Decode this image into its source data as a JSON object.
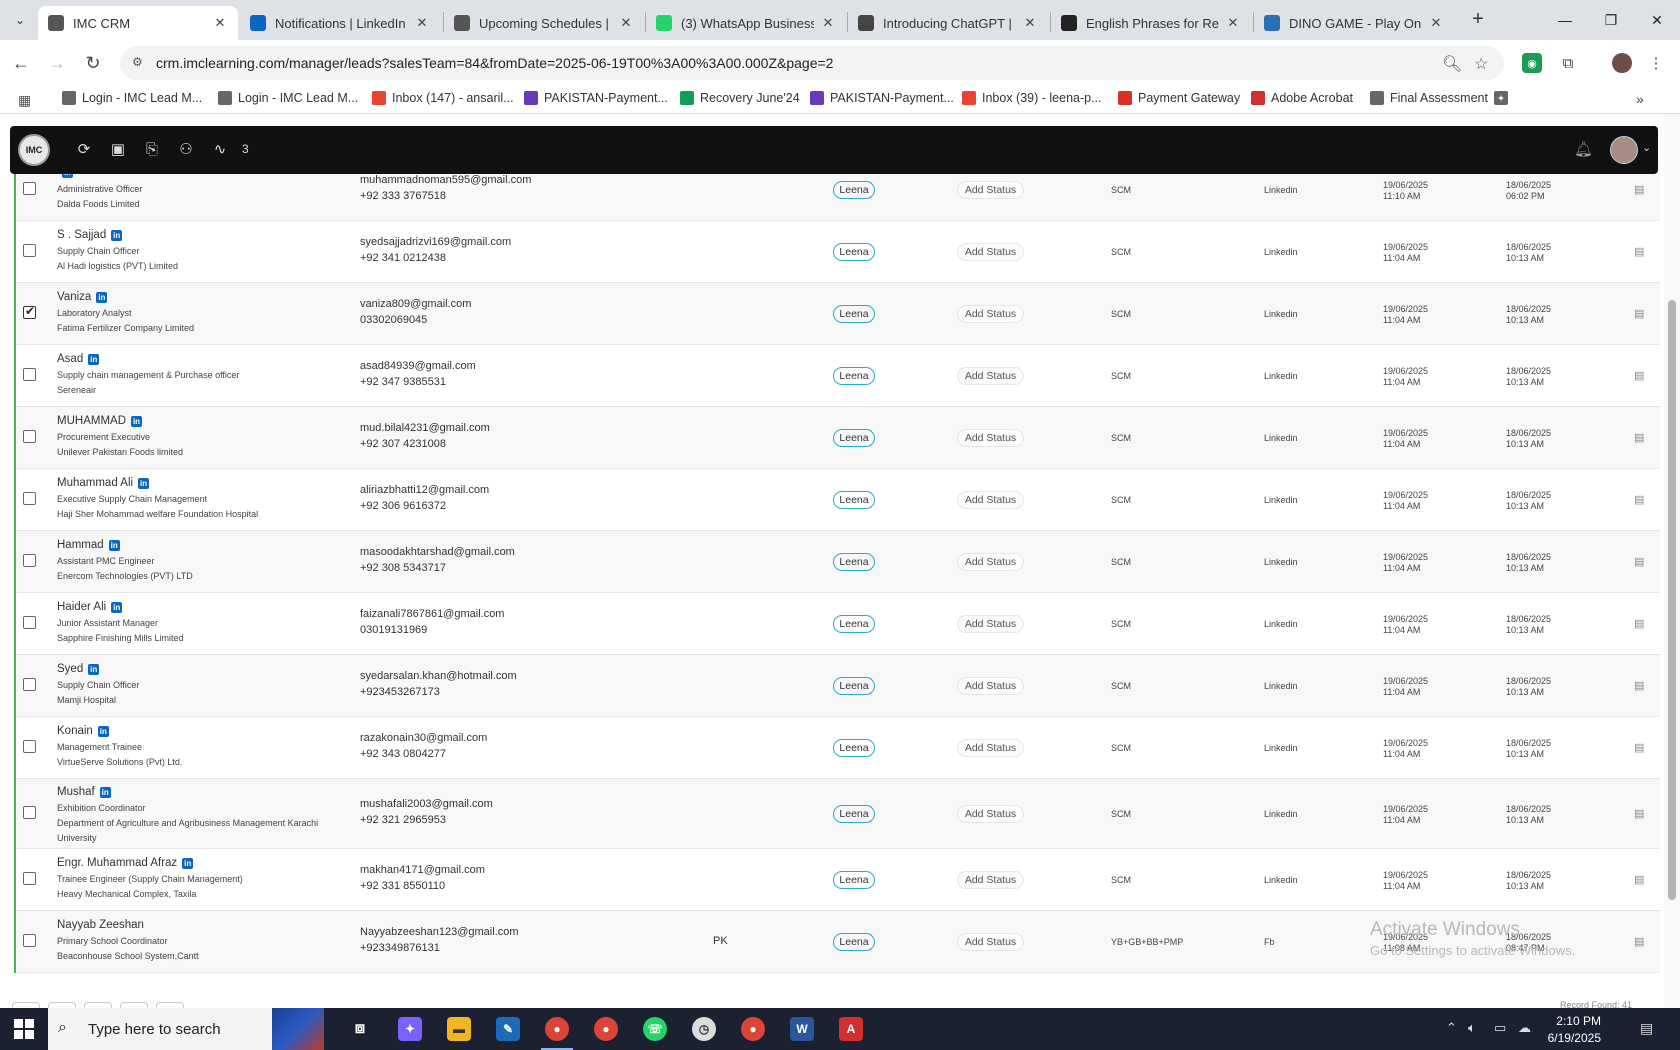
{
  "browser": {
    "tabs": [
      {
        "title": "IMC CRM",
        "favicon": "imc-icon",
        "color": "#555555"
      },
      {
        "title": "Notifications | LinkedIn",
        "favicon": "linkedin-icon",
        "color": "#0a66c2"
      },
      {
        "title": "Upcoming Schedules | IM",
        "favicon": "imc-icon",
        "color": "#555555"
      },
      {
        "title": "(3) WhatsApp Business",
        "favicon": "whatsapp-icon",
        "color": "#25d366"
      },
      {
        "title": "Introducing ChatGPT | O",
        "favicon": "openai-icon",
        "color": "#444444"
      },
      {
        "title": "English Phrases for Reas",
        "favicon": "openai-icon",
        "color": "#222222"
      },
      {
        "title": "DINO GAME - Play Onlin",
        "favicon": "dino-icon",
        "color": "#2a6fb0"
      }
    ],
    "url": "crm.imclearning.com/manager/leads?salesTeam=84&fromDate=2025-06-19T00%3A00%3A00.000Z&page=2",
    "bookmarks": [
      {
        "label": "Login - IMC Lead M...",
        "color": "#666666"
      },
      {
        "label": "Login - IMC Lead M...",
        "color": "#666666"
      },
      {
        "label": "Inbox (147) - ansaril...",
        "color": "#ea4335"
      },
      {
        "label": "PAKISTAN-Payment...",
        "color": "#673ab7"
      },
      {
        "label": "Recovery June'24",
        "color": "#0f9d58"
      },
      {
        "label": "PAKISTAN-Payment...",
        "color": "#673ab7"
      },
      {
        "label": "Inbox (39) - leena-p...",
        "color": "#ea4335"
      },
      {
        "label": "Payment Gateway",
        "color": "#d93025"
      },
      {
        "label": "Adobe Acrobat",
        "color": "#d32f2f"
      },
      {
        "label": "Final Assessment",
        "color": "#666666"
      }
    ]
  },
  "app": {
    "header_count": "3"
  },
  "leads": [
    {
      "name": "",
      "title": "Administrative Officer",
      "company": "Dalda Foods Limited",
      "org2": "",
      "email": "muhammadnoman595@gmail.com",
      "phone": "+92 333 3767518",
      "country": "",
      "owner": "Leena",
      "status": "Add Status",
      "course": "SCM",
      "source": "Linkedin",
      "date1": "19/06/2025",
      "time1": "11:10 AM",
      "date2": "18/06/2025",
      "time2": "06:02 PM",
      "checked": false,
      "linkedin": true
    },
    {
      "name": "S . Sajjad",
      "title": "Supply Chain Officer",
      "company": "Al Hadi logistics (PVT) Limited",
      "org2": "",
      "email": "syedsajjadrizvi169@gmail.com",
      "phone": "+92 341 0212438",
      "country": "",
      "owner": "Leena",
      "status": "Add Status",
      "course": "SCM",
      "source": "Linkedin",
      "date1": "19/06/2025",
      "time1": "11:04 AM",
      "date2": "18/06/2025",
      "time2": "10:13 AM",
      "checked": false,
      "linkedin": true
    },
    {
      "name": "Vaniza",
      "title": "Laboratory Analyst",
      "company": "Fatima Fertilizer Company Limited",
      "org2": "",
      "email": "vaniza809@gmail.com",
      "phone": "03302069045",
      "country": "",
      "owner": "Leena",
      "status": "Add Status",
      "course": "SCM",
      "source": "Linkedin",
      "date1": "19/06/2025",
      "time1": "11:04 AM",
      "date2": "18/06/2025",
      "time2": "10:13 AM",
      "checked": true,
      "linkedin": true
    },
    {
      "name": "Asad",
      "title": "Supply chain management & Purchase officer",
      "company": "Sereneair",
      "org2": "",
      "email": "asad84939@gmail.com",
      "phone": "+92 347 9385531",
      "country": "",
      "owner": "Leena",
      "status": "Add Status",
      "course": "SCM",
      "source": "Linkedin",
      "date1": "19/06/2025",
      "time1": "11:04 AM",
      "date2": "18/06/2025",
      "time2": "10:13 AM",
      "checked": false,
      "linkedin": true
    },
    {
      "name": "MUHAMMAD",
      "title": "Procurement Executive",
      "company": "Unilever Pakistan Foods limited",
      "org2": "",
      "email": "mud.bilal4231@gmail.com",
      "phone": "+92 307 4231008",
      "country": "",
      "owner": "Leena",
      "status": "Add Status",
      "course": "SCM",
      "source": "Linkedin",
      "date1": "19/06/2025",
      "time1": "11:04 AM",
      "date2": "18/06/2025",
      "time2": "10:13 AM",
      "checked": false,
      "linkedin": true
    },
    {
      "name": "Muhammad Ali",
      "title": "Executive Supply Chain Management",
      "company": "Haji Sher Mohammad welfare Foundation Hospital",
      "org2": "",
      "email": "aliriazbhatti12@gmail.com",
      "phone": "+92 306 9616372",
      "country": "",
      "owner": "Leena",
      "status": "Add Status",
      "course": "SCM",
      "source": "Linkedin",
      "date1": "19/06/2025",
      "time1": "11:04 AM",
      "date2": "18/06/2025",
      "time2": "10:13 AM",
      "checked": false,
      "linkedin": true
    },
    {
      "name": "Hammad",
      "title": "Assistant PMC Engineer",
      "company": "Enercom Technologies (PVT) LTD",
      "org2": "",
      "email": "masoodakhtarshad@gmail.com",
      "phone": "+92 308 5343717",
      "country": "",
      "owner": "Leena",
      "status": "Add Status",
      "course": "SCM",
      "source": "Linkedin",
      "date1": "19/06/2025",
      "time1": "11:04 AM",
      "date2": "18/06/2025",
      "time2": "10:13 AM",
      "checked": false,
      "linkedin": true
    },
    {
      "name": "Haider Ali",
      "title": "Junior Assistant Manager",
      "company": "Sapphire Finishing Mills Limited",
      "org2": "",
      "email": "faizanali7867861@gmail.com",
      "phone": "03019131969",
      "country": "",
      "owner": "Leena",
      "status": "Add Status",
      "course": "SCM",
      "source": "Linkedin",
      "date1": "19/06/2025",
      "time1": "11:04 AM",
      "date2": "18/06/2025",
      "time2": "10:13 AM",
      "checked": false,
      "linkedin": true
    },
    {
      "name": "Syed",
      "title": "Supply Chain Officer",
      "company": "Mamji Hospital",
      "org2": "",
      "email": "syedarsalan.khan@hotmail.com",
      "phone": "+923453267173",
      "country": "",
      "owner": "Leena",
      "status": "Add Status",
      "course": "SCM",
      "source": "Linkedin",
      "date1": "19/06/2025",
      "time1": "11:04 AM",
      "date2": "18/06/2025",
      "time2": "10:13 AM",
      "checked": false,
      "linkedin": true
    },
    {
      "name": "Konain",
      "title": "Management Trainee",
      "company": "VirtueServe Solutions (Pvt) Ltd.",
      "org2": "",
      "email": "razakonain30@gmail.com",
      "phone": "+92 343 0804277",
      "country": "",
      "owner": "Leena",
      "status": "Add Status",
      "course": "SCM",
      "source": "Linkedin",
      "date1": "19/06/2025",
      "time1": "11:04 AM",
      "date2": "18/06/2025",
      "time2": "10:13 AM",
      "checked": false,
      "linkedin": true
    },
    {
      "name": "Mushaf",
      "title": "Exhibition Coordinator",
      "company": "Department of Agriculture and Agribusiness Management Karachi",
      "org2": "University",
      "email": "mushafali2003@gmail.com",
      "phone": "+92 321 2965953",
      "country": "",
      "owner": "Leena",
      "status": "Add Status",
      "course": "SCM",
      "source": "Linkedin",
      "date1": "19/06/2025",
      "time1": "11:04 AM",
      "date2": "18/06/2025",
      "time2": "10:13 AM",
      "checked": false,
      "linkedin": true,
      "tall": true
    },
    {
      "name": "Engr. Muhammad Afraz",
      "title": "Trainee Engineer (Supply Chain Management)",
      "company": "Heavy Mechanical Complex, Taxila",
      "org2": "",
      "email": "makhan4171@gmail.com",
      "phone": "+92 331 8550110",
      "country": "",
      "owner": "Leena",
      "status": "Add Status",
      "course": "SCM",
      "source": "Linkedin",
      "date1": "19/06/2025",
      "time1": "11:04 AM",
      "date2": "18/06/2025",
      "time2": "10:13 AM",
      "checked": false,
      "linkedin": true
    },
    {
      "name": "Nayyab Zeeshan",
      "title": "Primary School Coordinator",
      "company": "Beaconhouse School System,Cantt",
      "org2": "",
      "email": "Nayyabzeeshan123@gmail.com",
      "phone": "+923349876131",
      "country": "PK",
      "owner": "Leena",
      "status": "Add Status",
      "course": "YB+GB+BB+PMP",
      "source": "Fb",
      "date1": "19/06/2025",
      "time1": "11:08 AM",
      "date2": "18/06/2025",
      "time2": "08:47 PM",
      "checked": false,
      "linkedin": false
    }
  ],
  "footer": {
    "record_found": "Record Found: 41"
  },
  "watermark": {
    "title": "Activate Windows",
    "subtitle": "Go to Settings to activate Windows."
  },
  "taskbar": {
    "search_placeholder": "Type here to search",
    "time": "2:10 PM",
    "date": "6/19/2025"
  }
}
